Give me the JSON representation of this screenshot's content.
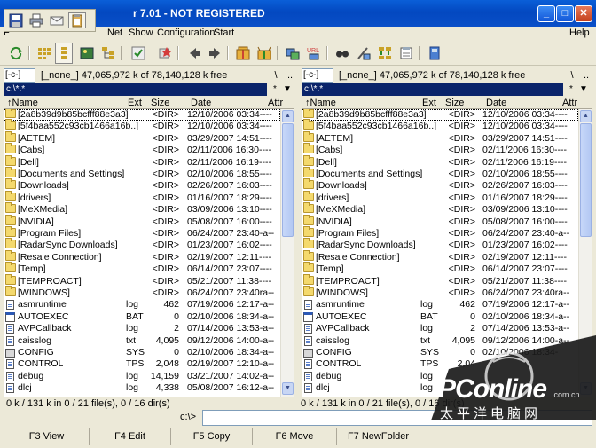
{
  "window": {
    "title": "r 7.01 - NOT REGISTERED",
    "minimize": "_",
    "maximize": "□",
    "close": "✕"
  },
  "menu": {
    "file": "F",
    "net": "Net",
    "show": "Show",
    "configuration": "Configuration",
    "start": "Start",
    "help": "Help"
  },
  "toolbar": {
    "icons": [
      "refresh-icon",
      "brief-view-icon",
      "full-view-icon",
      "thumbnails-icon",
      "tree-icon",
      "invert-selection-icon",
      "select-all-icon",
      "back-icon",
      "forward-icon",
      "pack-icon",
      "unpack-icon",
      "ftp-icon",
      "new-ftp-icon",
      "search-icon",
      "multi-rename-icon",
      "sync-dirs-icon",
      "notepad-icon",
      "install-icon"
    ]
  },
  "left_panel": {
    "drive": "[-c-]",
    "free_space": "[_none_]  47,065,972 k of 78,140,128 k free",
    "path": "c:\\*.*",
    "root_btn": "\\",
    "up_btn": "..",
    "star_btn": "*",
    "dropdown_btn": "▼",
    "columns": [
      "↑Name",
      "Ext",
      "Size",
      "Date",
      "Attr"
    ],
    "rows": [
      {
        "name": "[2a8b39d9b85bcfff88e3a3]",
        "ext": "",
        "size": "<DIR>",
        "date": "12/10/2006 03:34----",
        "type": "folder"
      },
      {
        "name": "[5f4baa552c93cb1466a16b..]",
        "ext": "",
        "size": "<DIR>",
        "date": "12/10/2006 03:34----",
        "type": "folder"
      },
      {
        "name": "[AETEM]",
        "ext": "",
        "size": "<DIR>",
        "date": "03/29/2007 14:51----",
        "type": "folder"
      },
      {
        "name": "[Cabs]",
        "ext": "",
        "size": "<DIR>",
        "date": "02/11/2006 16:30----",
        "type": "folder"
      },
      {
        "name": "[Dell]",
        "ext": "",
        "size": "<DIR>",
        "date": "02/11/2006 16:19----",
        "type": "folder"
      },
      {
        "name": "[Documents and Settings]",
        "ext": "",
        "size": "<DIR>",
        "date": "02/10/2006 18:55----",
        "type": "folder"
      },
      {
        "name": "[Downloads]",
        "ext": "",
        "size": "<DIR>",
        "date": "02/26/2007 16:03----",
        "type": "folder"
      },
      {
        "name": "[drivers]",
        "ext": "",
        "size": "<DIR>",
        "date": "01/16/2007 18:29----",
        "type": "folder"
      },
      {
        "name": "[MeXMedia]",
        "ext": "",
        "size": "<DIR>",
        "date": "03/09/2006 13:10----",
        "type": "folder"
      },
      {
        "name": "[NVIDIA]",
        "ext": "",
        "size": "<DIR>",
        "date": "05/08/2007 16:00----",
        "type": "folder"
      },
      {
        "name": "[Program Files]",
        "ext": "",
        "size": "<DIR>",
        "date": "06/24/2007 23:40-a--",
        "type": "folder"
      },
      {
        "name": "[RadarSync Downloads]",
        "ext": "",
        "size": "<DIR>",
        "date": "01/23/2007 16:02----",
        "type": "folder"
      },
      {
        "name": "[Resale Connection]",
        "ext": "",
        "size": "<DIR>",
        "date": "02/19/2007 12:11----",
        "type": "folder"
      },
      {
        "name": "[Temp]",
        "ext": "",
        "size": "<DIR>",
        "date": "06/14/2007 23:07----",
        "type": "folder"
      },
      {
        "name": "[TEMPROACT]",
        "ext": "",
        "size": "<DIR>",
        "date": "05/21/2007 11:38----",
        "type": "folder"
      },
      {
        "name": "[WINDOWS]",
        "ext": "",
        "size": "<DIR>",
        "date": "06/24/2007 23:40ra--",
        "type": "folder"
      },
      {
        "name": "asmruntime",
        "ext": "log",
        "size": "462",
        "date": "07/19/2006 12:17-a--",
        "type": "file"
      },
      {
        "name": "AUTOEXEC",
        "ext": "BAT",
        "size": "0",
        "date": "02/10/2006 18:34-a--",
        "type": "exe"
      },
      {
        "name": "AVPCallback",
        "ext": "log",
        "size": "2",
        "date": "07/14/2006 13:53-a--",
        "type": "file"
      },
      {
        "name": "caisslog",
        "ext": "txt",
        "size": "4,095",
        "date": "09/12/2006 14:00-a--",
        "type": "file"
      },
      {
        "name": "CONFIG",
        "ext": "SYS",
        "size": "0",
        "date": "02/10/2006 18:34-a--",
        "type": "sys"
      },
      {
        "name": "CONTROL",
        "ext": "TPS",
        "size": "2,048",
        "date": "02/19/2007 12:10-a--",
        "type": "file"
      },
      {
        "name": "debug",
        "ext": "log",
        "size": "14,159",
        "date": "03/21/2007 14:02-a--",
        "type": "file"
      },
      {
        "name": "dlcj",
        "ext": "log",
        "size": "4,338",
        "date": "05/08/2007 16:12-a--",
        "type": "file"
      }
    ],
    "status": "0 k / 131 k in 0 / 21 file(s), 0 / 16 dir(s)"
  },
  "right_panel": {
    "drive": "[-c-]",
    "free_space": "[_none_]  47,065,972 k of 78,140,128 k free",
    "path": "c:\\*.*",
    "root_btn": "\\",
    "up_btn": "..",
    "star_btn": "*",
    "dropdown_btn": "▼",
    "columns": [
      "↑Name",
      "Ext",
      "Size",
      "Date",
      "Attr"
    ],
    "rows": [
      {
        "name": "[2a8b39d9b85bcfff88e3a3]",
        "ext": "",
        "size": "<DIR>",
        "date": "12/10/2006 03:34----",
        "type": "folder"
      },
      {
        "name": "[5f4baa552c93cb1466a16b..]",
        "ext": "",
        "size": "<DIR>",
        "date": "12/10/2006 03:34----",
        "type": "folder"
      },
      {
        "name": "[AETEM]",
        "ext": "",
        "size": "<DIR>",
        "date": "03/29/2007 14:51----",
        "type": "folder"
      },
      {
        "name": "[Cabs]",
        "ext": "",
        "size": "<DIR>",
        "date": "02/11/2006 16:30----",
        "type": "folder"
      },
      {
        "name": "[Dell]",
        "ext": "",
        "size": "<DIR>",
        "date": "02/11/2006 16:19----",
        "type": "folder"
      },
      {
        "name": "[Documents and Settings]",
        "ext": "",
        "size": "<DIR>",
        "date": "02/10/2006 18:55----",
        "type": "folder"
      },
      {
        "name": "[Downloads]",
        "ext": "",
        "size": "<DIR>",
        "date": "02/26/2007 16:03----",
        "type": "folder"
      },
      {
        "name": "[drivers]",
        "ext": "",
        "size": "<DIR>",
        "date": "01/16/2007 18:29----",
        "type": "folder"
      },
      {
        "name": "[MeXMedia]",
        "ext": "",
        "size": "<DIR>",
        "date": "03/09/2006 13:10----",
        "type": "folder"
      },
      {
        "name": "[NVIDIA]",
        "ext": "",
        "size": "<DIR>",
        "date": "05/08/2007 16:00----",
        "type": "folder"
      },
      {
        "name": "[Program Files]",
        "ext": "",
        "size": "<DIR>",
        "date": "06/24/2007 23:40-a--",
        "type": "folder"
      },
      {
        "name": "[RadarSync Downloads]",
        "ext": "",
        "size": "<DIR>",
        "date": "01/23/2007 16:02----",
        "type": "folder"
      },
      {
        "name": "[Resale Connection]",
        "ext": "",
        "size": "<DIR>",
        "date": "02/19/2007 12:11----",
        "type": "folder"
      },
      {
        "name": "[Temp]",
        "ext": "",
        "size": "<DIR>",
        "date": "06/14/2007 23:07----",
        "type": "folder"
      },
      {
        "name": "[TEMPROACT]",
        "ext": "",
        "size": "<DIR>",
        "date": "05/21/2007 11:38----",
        "type": "folder"
      },
      {
        "name": "[WINDOWS]",
        "ext": "",
        "size": "<DIR>",
        "date": "06/24/2007 23:40ra--",
        "type": "folder"
      },
      {
        "name": "asmruntime",
        "ext": "log",
        "size": "462",
        "date": "07/19/2006 12:17-a--",
        "type": "file"
      },
      {
        "name": "AUTOEXEC",
        "ext": "BAT",
        "size": "0",
        "date": "02/10/2006 18:34-a--",
        "type": "exe"
      },
      {
        "name": "AVPCallback",
        "ext": "log",
        "size": "2",
        "date": "07/14/2006 13:53-a--",
        "type": "file"
      },
      {
        "name": "caisslog",
        "ext": "txt",
        "size": "4,095",
        "date": "09/12/2006 14:00-a--",
        "type": "file"
      },
      {
        "name": "CONFIG",
        "ext": "SYS",
        "size": "0",
        "date": "02/10/2006 18:34-",
        "type": "sys"
      },
      {
        "name": "CONTROL",
        "ext": "TPS",
        "size": "2,04",
        "date": "",
        "type": "file"
      },
      {
        "name": "debug",
        "ext": "log",
        "size": "",
        "date": "",
        "type": "file"
      },
      {
        "name": "dlcj",
        "ext": "log",
        "size": "",
        "date": "",
        "type": "file"
      }
    ],
    "status": "0 k / 131 k in 0 / 21 file(s), 0 / 16 dir(s)"
  },
  "command": {
    "label": "c:\\>",
    "value": ""
  },
  "fkeys": [
    "F3 View",
    "F4 Edit",
    "F5 Copy",
    "F6 Move",
    "F7 NewFolder"
  ],
  "watermark": {
    "brand": "PConline",
    "domain": ".com.cn",
    "chinese": "太平洋电脑网"
  }
}
